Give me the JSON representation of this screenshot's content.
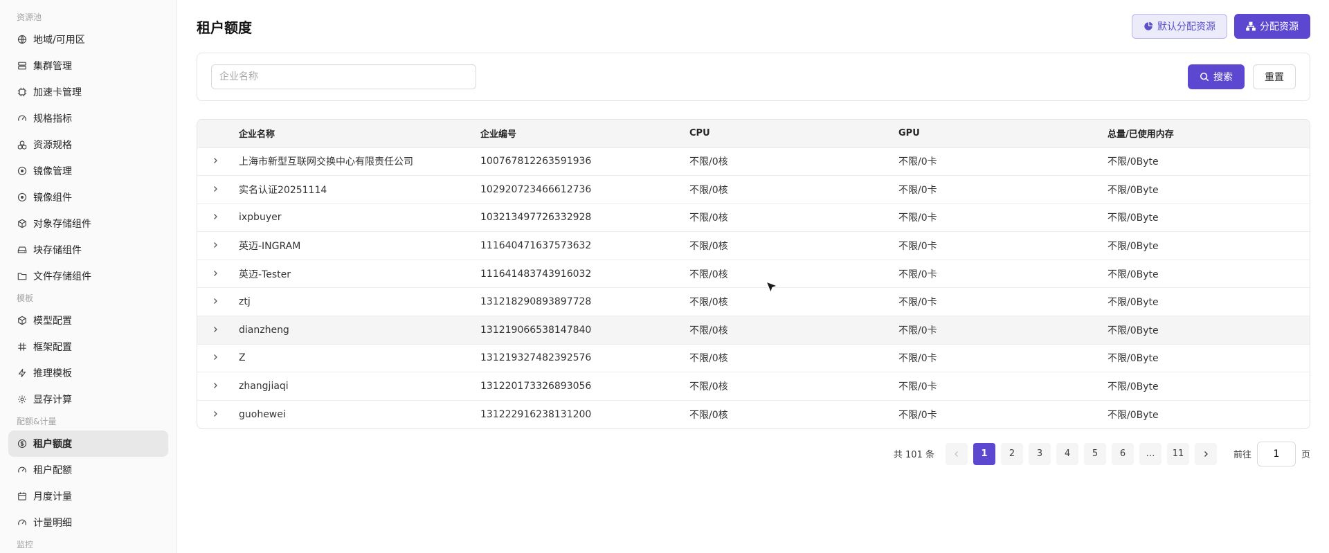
{
  "sidebar": {
    "sections": [
      {
        "title": "资源池",
        "items": [
          {
            "label": "地域/可用区",
            "icon": "globe-icon"
          },
          {
            "label": "集群管理",
            "icon": "server-icon"
          },
          {
            "label": "加速卡管理",
            "icon": "chip-icon"
          },
          {
            "label": "规格指标",
            "icon": "gauge-icon"
          },
          {
            "label": "资源规格",
            "icon": "boxes-icon"
          },
          {
            "label": "镜像管理",
            "icon": "disc-icon"
          },
          {
            "label": "镜像组件",
            "icon": "disc-icon"
          },
          {
            "label": "对象存储组件",
            "icon": "cube-icon"
          },
          {
            "label": "块存储组件",
            "icon": "drive-icon"
          },
          {
            "label": "文件存储组件",
            "icon": "folder-icon"
          }
        ]
      },
      {
        "title": "模板",
        "items": [
          {
            "label": "模型配置",
            "icon": "cube-icon"
          },
          {
            "label": "框架配置",
            "icon": "hash-icon"
          },
          {
            "label": "推理模板",
            "icon": "bolt-icon"
          },
          {
            "label": "显存计算",
            "icon": "gear-icon"
          }
        ]
      },
      {
        "title": "配额&计量",
        "items": [
          {
            "label": "租户额度",
            "icon": "dollar-icon",
            "active": true
          },
          {
            "label": "租户配额",
            "icon": "gauge-icon"
          },
          {
            "label": "月度计量",
            "icon": "calendar-icon"
          },
          {
            "label": "计量明细",
            "icon": "gauge-icon"
          }
        ]
      },
      {
        "title": "监控",
        "items": []
      }
    ]
  },
  "header": {
    "title": "租户额度",
    "default_allocate_label": "默认分配资源",
    "allocate_label": "分配资源"
  },
  "search": {
    "placeholder": "企业名称",
    "search_label": "搜索",
    "reset_label": "重置"
  },
  "table": {
    "columns": [
      "企业名称",
      "企业编号",
      "CPU",
      "GPU",
      "总量/已使用内存"
    ],
    "rows": [
      [
        "上海市新型互联网交换中心有限责任公司",
        "100767812263591936",
        "不限/0核",
        "不限/0卡",
        "不限/0Byte"
      ],
      [
        "实名认证20251114",
        "102920723466612736",
        "不限/0核",
        "不限/0卡",
        "不限/0Byte"
      ],
      [
        "ixpbuyer",
        "103213497726332928",
        "不限/0核",
        "不限/0卡",
        "不限/0Byte"
      ],
      [
        "英迈-INGRAM",
        "111640471637573632",
        "不限/0核",
        "不限/0卡",
        "不限/0Byte"
      ],
      [
        "英迈-Tester",
        "111641483743916032",
        "不限/0核",
        "不限/0卡",
        "不限/0Byte"
      ],
      [
        "ztj",
        "131218290893897728",
        "不限/0核",
        "不限/0卡",
        "不限/0Byte"
      ],
      [
        "dianzheng",
        "131219066538147840",
        "不限/0核",
        "不限/0卡",
        "不限/0Byte"
      ],
      [
        "Z",
        "131219327482392576",
        "不限/0核",
        "不限/0卡",
        "不限/0Byte"
      ],
      [
        "zhangjiaqi",
        "131220173326893056",
        "不限/0核",
        "不限/0卡",
        "不限/0Byte"
      ],
      [
        "guohewei",
        "131222916238131200",
        "不限/0核",
        "不限/0卡",
        "不限/0Byte"
      ]
    ]
  },
  "pagination": {
    "total_text": "共 101 条",
    "pages": [
      "1",
      "2",
      "3",
      "4",
      "5",
      "6",
      "…",
      "11"
    ],
    "current": "1",
    "goto_prefix": "前往",
    "goto_value": "1",
    "goto_suffix": "页"
  }
}
